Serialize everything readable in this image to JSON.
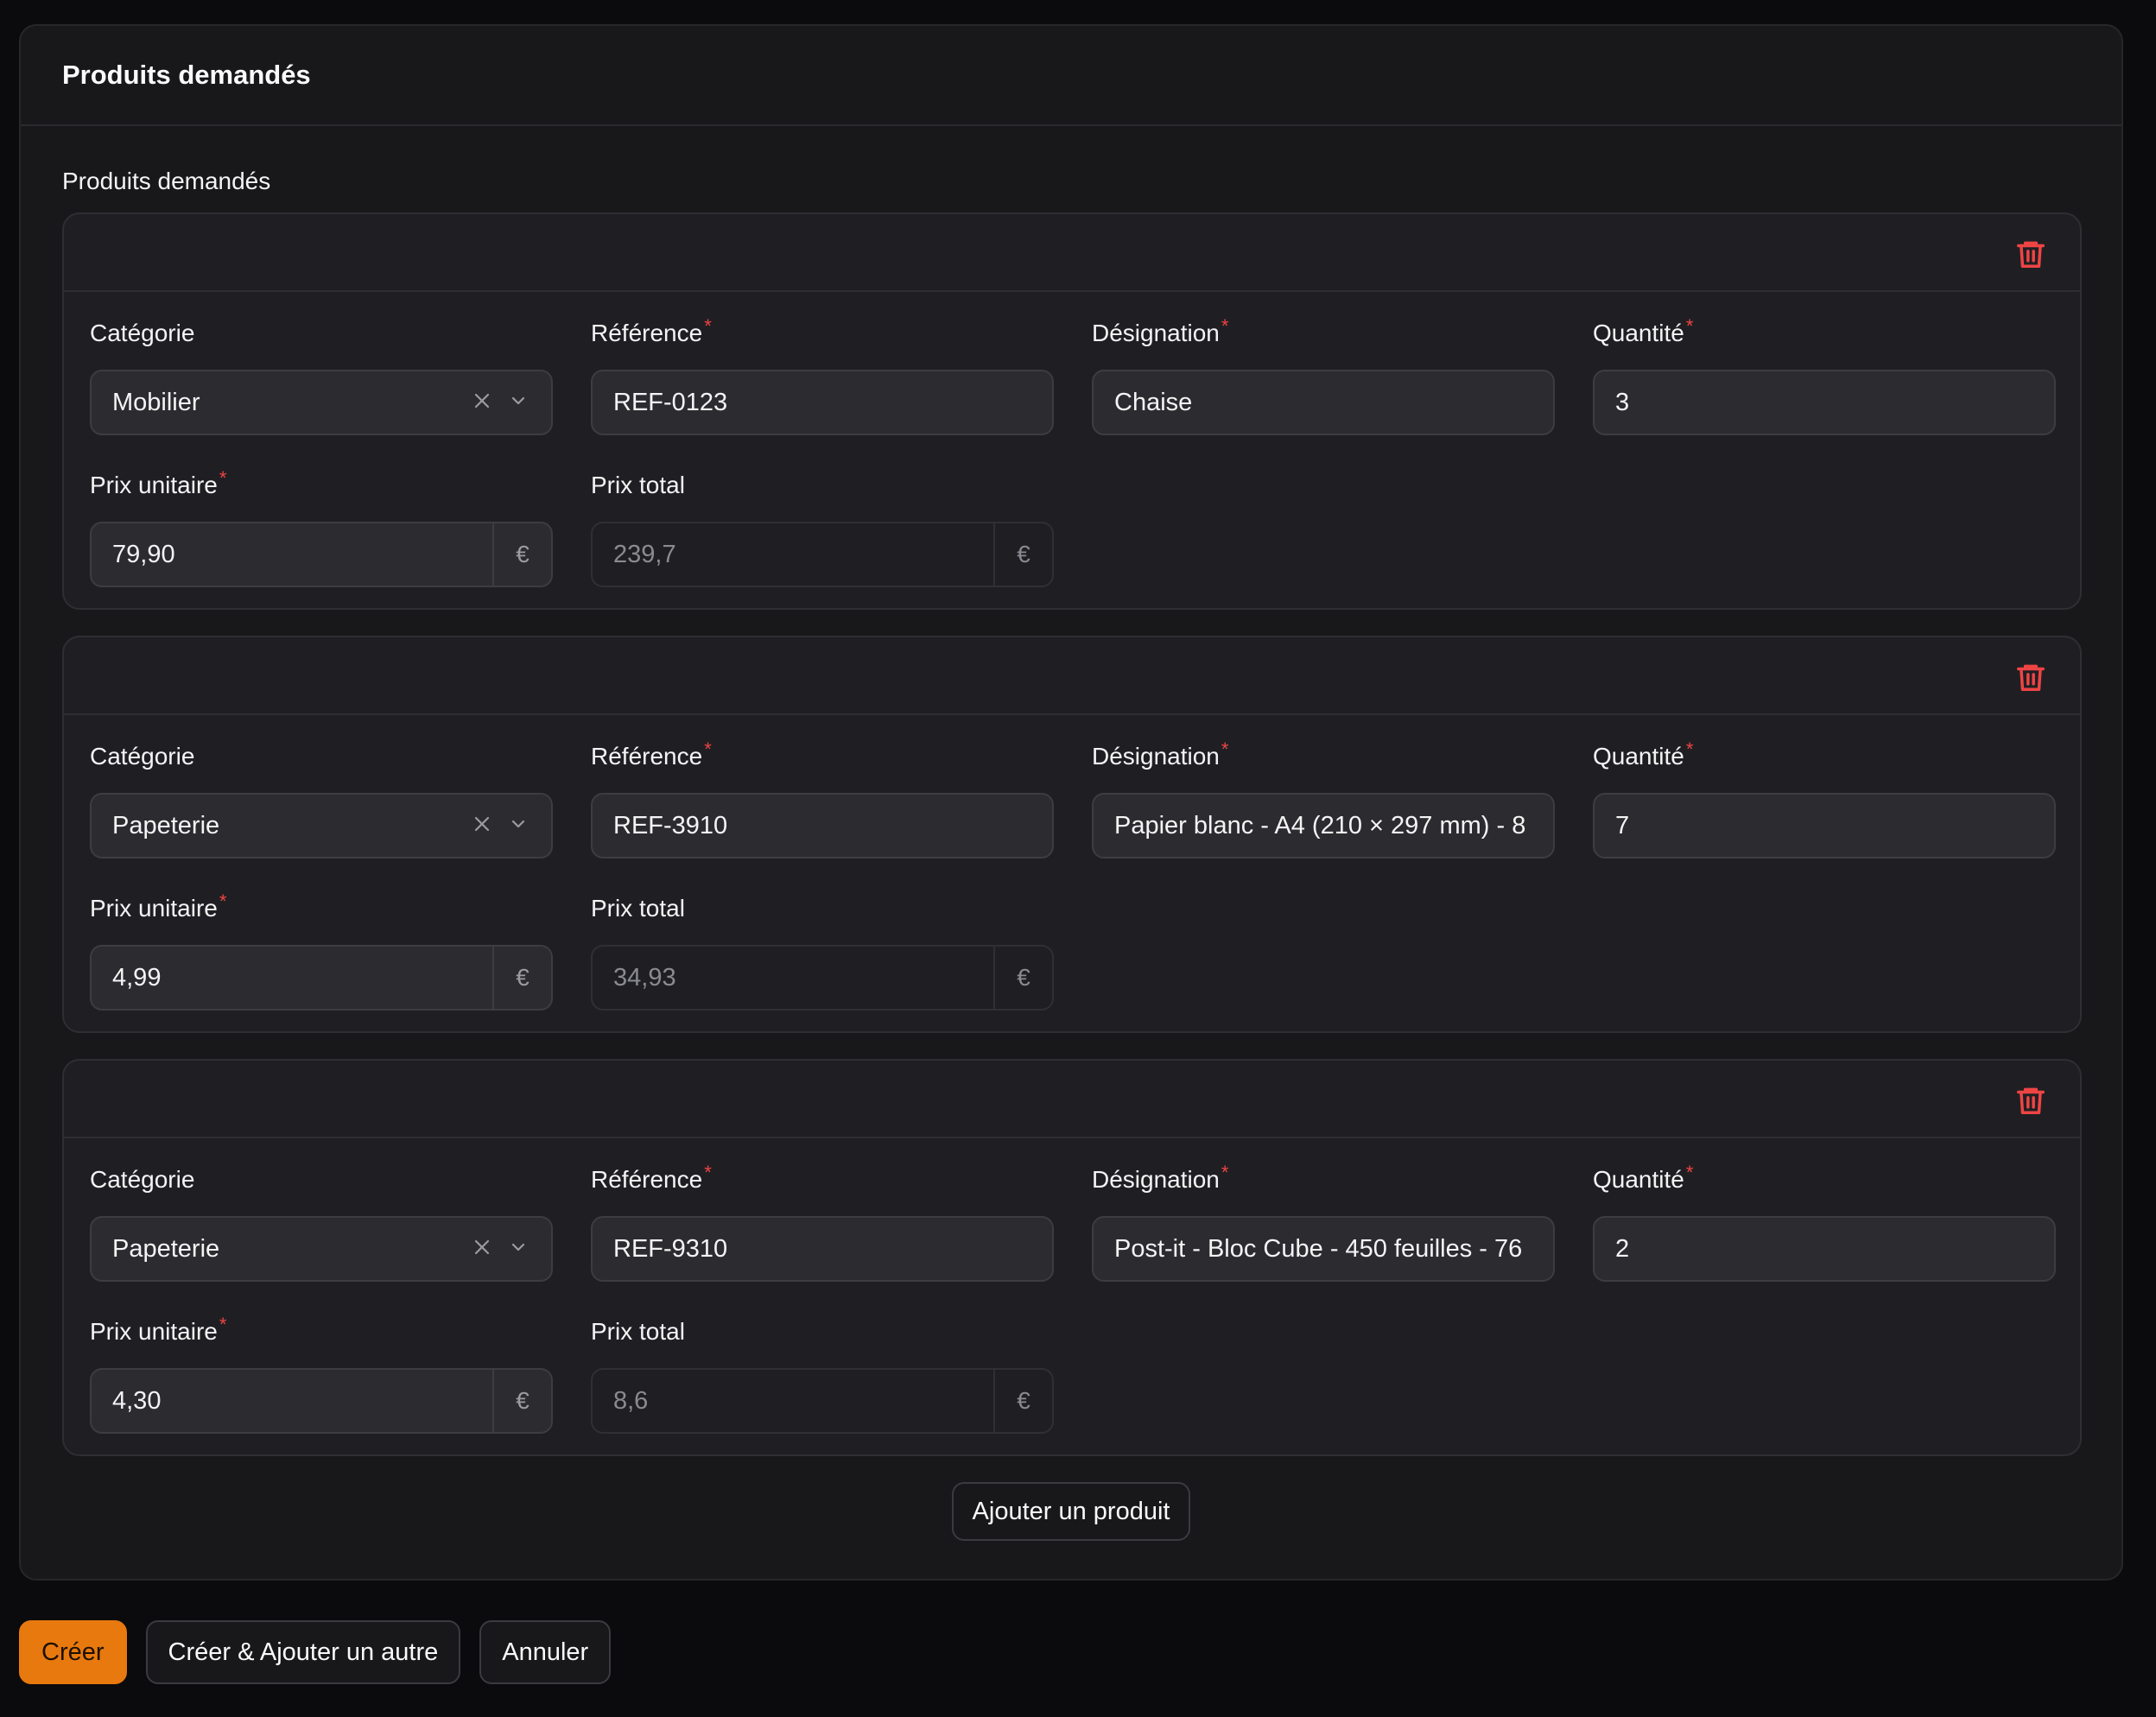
{
  "section": {
    "title": "Produits demandés",
    "repeater_label": "Produits demandés"
  },
  "labels": {
    "category": "Catégorie",
    "reference": "Référence",
    "designation": "Désignation",
    "quantity": "Quantité",
    "unit_price": "Prix unitaire",
    "total_price": "Prix total",
    "required_mark": "*",
    "currency": "€"
  },
  "items": [
    {
      "category": "Mobilier",
      "reference": "REF-0123",
      "designation": "Chaise",
      "quantity": "3",
      "unit_price": "79,90",
      "total_price": "239,7"
    },
    {
      "category": "Papeterie",
      "reference": "REF-3910",
      "designation": "Papier blanc - A4 (210 × 297 mm) - 8",
      "quantity": "7",
      "unit_price": "4,99",
      "total_price": "34,93"
    },
    {
      "category": "Papeterie",
      "reference": "REF-9310",
      "designation": "Post-it - Bloc Cube - 450 feuilles - 76",
      "quantity": "2",
      "unit_price": "4,30",
      "total_price": "8,6"
    }
  ],
  "actions": {
    "add_product": "Ajouter un produit",
    "create": "Créer",
    "create_another": "Créer & Ajouter un autre",
    "cancel": "Annuler"
  },
  "colors": {
    "accent": "#e8790e",
    "danger": "#ef4444",
    "background": "#0b0b0d",
    "surface": "#18181b"
  },
  "icons": {
    "delete": "trash-icon",
    "clear": "close-icon",
    "dropdown": "chevron-down-icon"
  }
}
